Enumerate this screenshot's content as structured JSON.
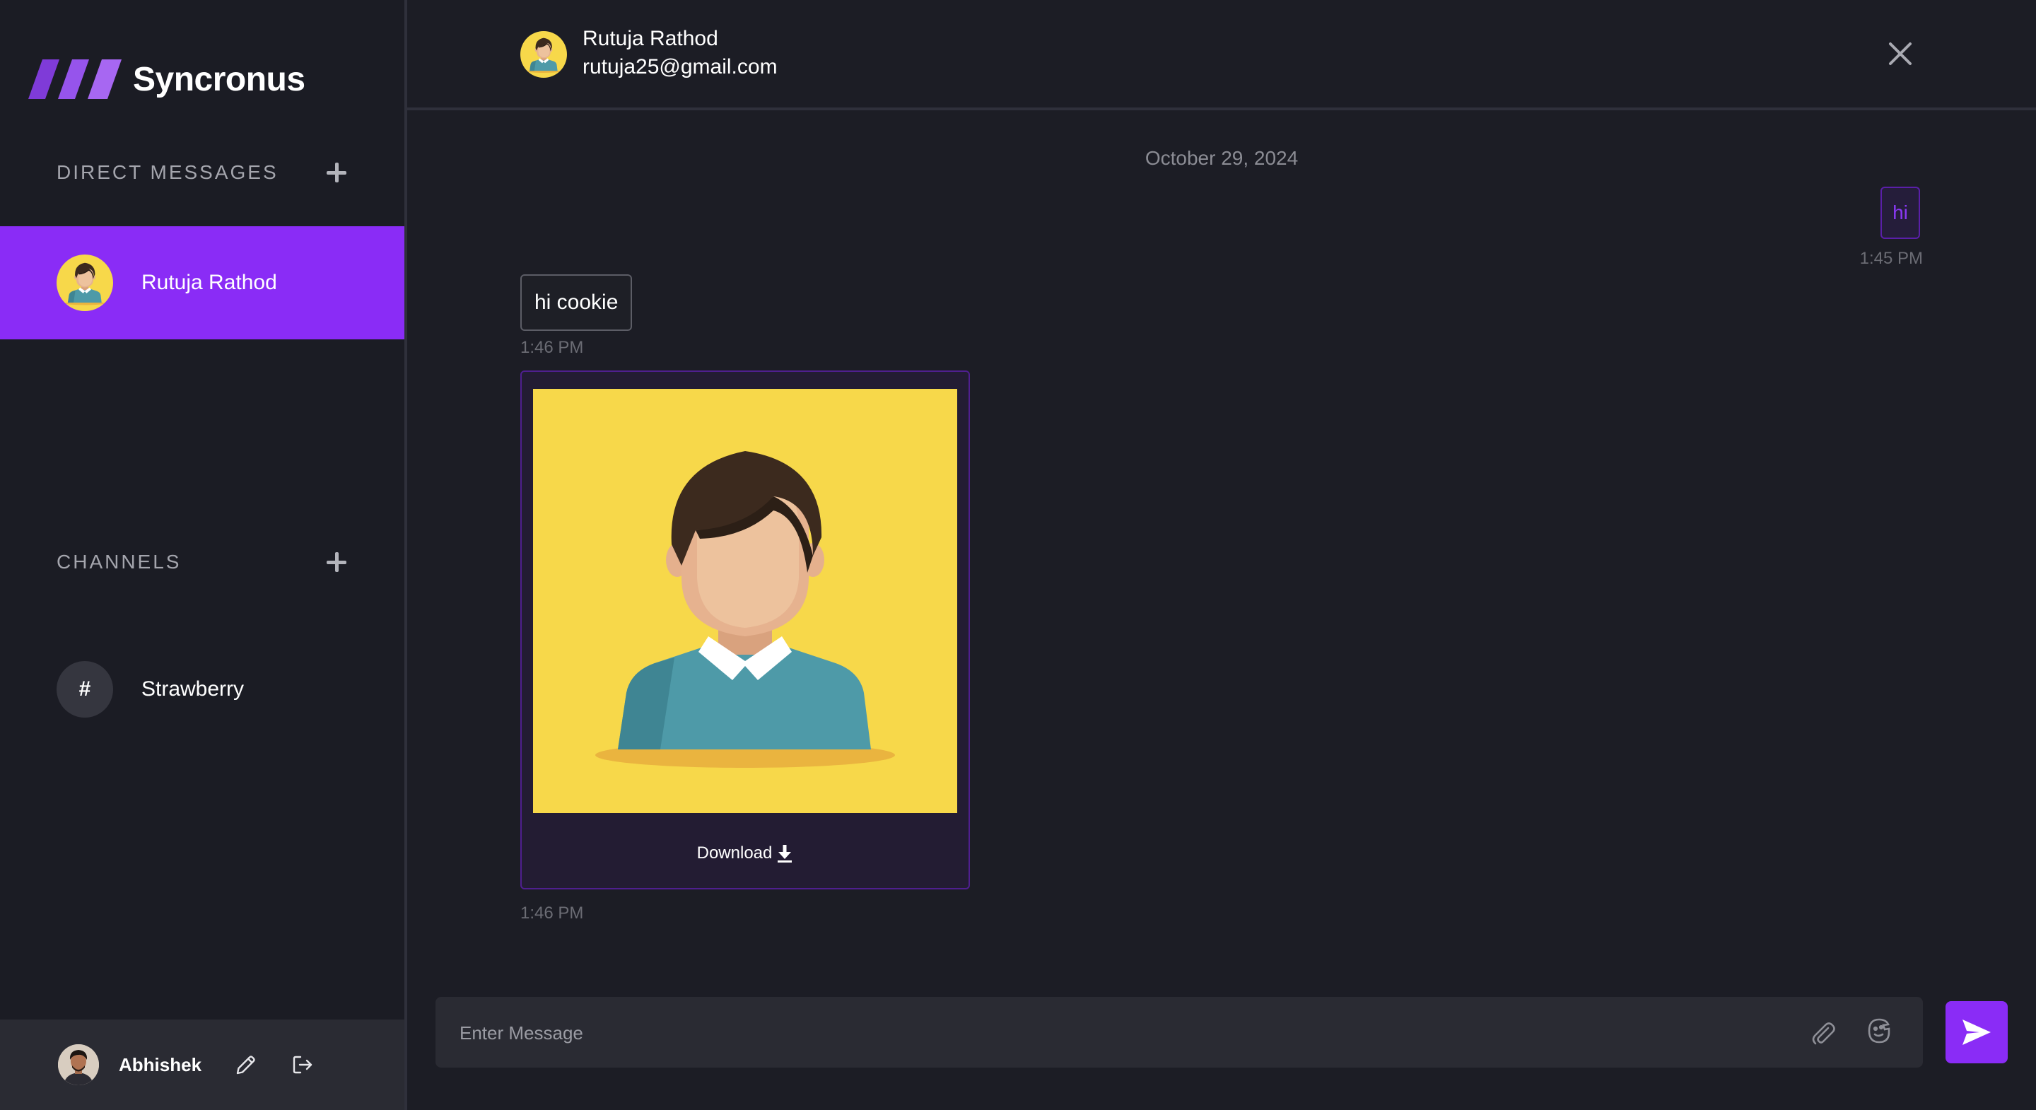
{
  "app": {
    "name": "Syncronus",
    "accent": "#8a2cf6"
  },
  "sidebar": {
    "direct_messages_title": "DIRECT MESSAGES",
    "channels_title": "CHANNELS",
    "contacts": [
      {
        "name": "Rutuja Rathod",
        "avatar_icon": "user-avatar-icon"
      }
    ],
    "channels": [
      {
        "symbol": "#",
        "name": "Strawberry"
      }
    ],
    "profile": {
      "name": "Abhishek",
      "avatar_icon": "profile-photo"
    }
  },
  "chat": {
    "contact": {
      "name": "Rutuja Rathod",
      "email": "rutuja25@gmail.com"
    },
    "date_separator": "October 29, 2024",
    "messages": [
      {
        "direction": "sent",
        "text": "hi",
        "time": "1:45 PM"
      },
      {
        "direction": "received",
        "text": "hi cookie",
        "time": "1:46 PM"
      },
      {
        "direction": "received",
        "type": "image",
        "download_label": "Download",
        "time": "1:46 PM"
      }
    ],
    "input": {
      "placeholder": "Enter Message",
      "value": ""
    }
  }
}
